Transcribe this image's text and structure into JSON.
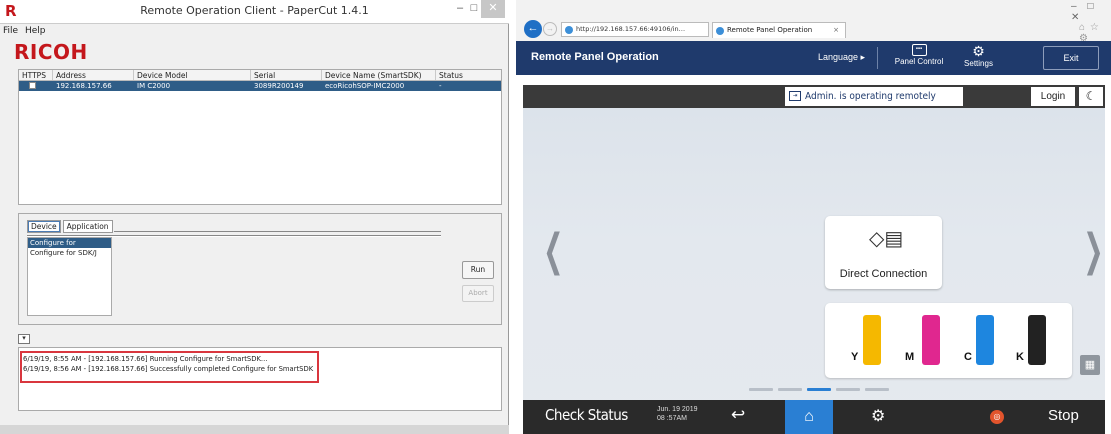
{
  "left_window": {
    "title": "Remote Operation Client - PaperCut 1.4.1",
    "app_icon": "R",
    "menu": [
      "File",
      "Help"
    ],
    "logo_text": "RICOH",
    "device_table": {
      "headers": [
        "HTTPS",
        "Address",
        "Device Model",
        "Serial",
        "Device Name (SmartSDK)",
        "Status"
      ],
      "rows": [
        {
          "address": "192.168.157.66",
          "model": "IM C2000",
          "serial": "3089R200149",
          "name": "ecoRicohSOP-IMC2000",
          "status": "-"
        }
      ]
    },
    "tabs": [
      "Device",
      "Application"
    ],
    "config_items": [
      "Configure for SmartSDK",
      "Configure for SDK/J"
    ],
    "run_label": "Run",
    "abort_label": "Abort",
    "log_lines": [
      "6/19/19, 8:55 AM - [192.168.157.66] Running Configure for SmartSDK...",
      "6/19/19, 8:56 AM - [192.168.157.66] Successfully completed Configure for SmartSDK"
    ]
  },
  "right_window": {
    "address_bar": "http://192.168.157.66:49106/in…",
    "tab_title": "Remote Panel Operation",
    "header": {
      "title": "Remote Panel Operation",
      "language": "Language ▸",
      "panel_control": "Panel Control",
      "settings": "Settings",
      "exit": "Exit"
    },
    "status_msg": "Admin. is operating remotely",
    "login": "Login",
    "direct_connection": "Direct Connection",
    "toners": [
      {
        "label": "Y",
        "color": "#f5b800"
      },
      {
        "label": "M",
        "color": "#e0278f"
      },
      {
        "label": "C",
        "color": "#1e86df"
      },
      {
        "label": "K",
        "color": "#222222"
      }
    ],
    "bottom": {
      "check_status": "Check Status",
      "date": "Jun. 19 2019",
      "time": "08 :57AM",
      "stop": "Stop"
    }
  }
}
